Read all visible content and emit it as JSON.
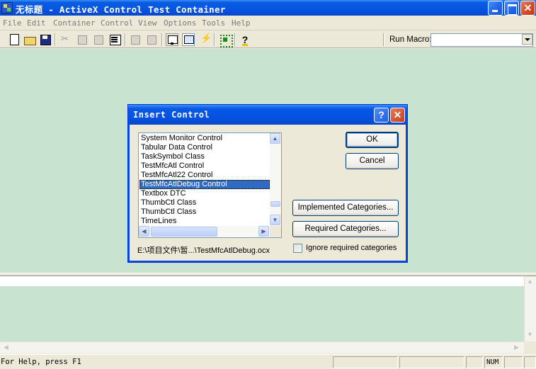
{
  "window": {
    "title": "无标题 - ActiveX Control Test Container",
    "minimize_icon": "minimize-icon",
    "maximize_icon": "maximize-icon",
    "close_glyph": "✕"
  },
  "menu": [
    "File",
    "Edit",
    "Container",
    "Control",
    "View",
    "Options",
    "Tools",
    "Help"
  ],
  "toolbar": {
    "icons": [
      "new-icon",
      "open-icon",
      "save-icon",
      "cut-icon",
      "copy-icon",
      "paste-icon",
      "properties-icon",
      "invoke-methods-icon",
      "property-page-icon",
      "design-mode-icon",
      "run-mode-icon",
      "event-log-icon",
      "grid-icon",
      "help-icon"
    ],
    "help_glyph": "?",
    "run_macro_label": "Run Macro:",
    "run_macro_value": ""
  },
  "dialog": {
    "title": "Insert Control",
    "help_glyph": "?",
    "close_glyph": "✕",
    "controls": [
      "System Monitor Control",
      "Tabular Data Control",
      "TaskSymbol Class",
      "TestMfcAtl Control",
      "TestMfcAtl22 Control",
      "TestMfcAtlDebug Control",
      "Textbox DTC",
      "ThumbCtl Class",
      "ThumbCtl Class",
      "TimeLines"
    ],
    "selected_index": 5,
    "path": "E:\\项目文件\\暂...\\TestMfcAtlDebug.ocx",
    "ok_label": "OK",
    "cancel_label": "Cancel",
    "implemented_label": "Implemented Categories...",
    "required_label": "Required Categories...",
    "ignore_label": "Ignore required categories",
    "ignore_checked": false
  },
  "status": {
    "help_text": "For Help, press F1",
    "num_indicator": "NUM"
  }
}
